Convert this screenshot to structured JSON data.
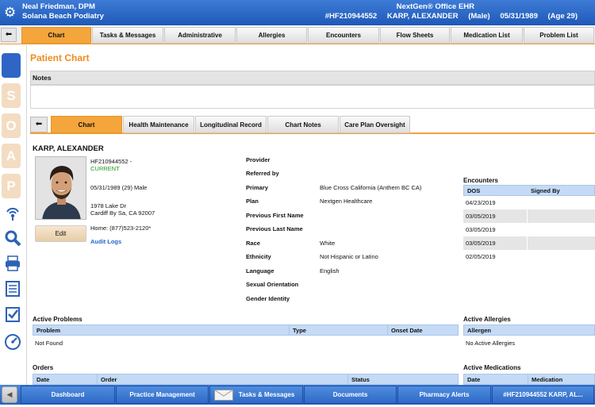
{
  "header": {
    "provider_name": "Neal Friedman, DPM",
    "practice_name": "Solana Beach Podiatry",
    "app_title": "NextGen® Office EHR",
    "patient_id": "#HF210944552",
    "patient_name": "KARP, ALEXANDER",
    "patient_sex": "(Male)",
    "patient_dob": "05/31/1989",
    "patient_age": "(Age 29)"
  },
  "nav": {
    "back_glyph": "⬅",
    "tabs": [
      "Chart",
      "Tasks & Messages",
      "Administrative",
      "Allergies",
      "Encounters",
      "Flow Sheets",
      "Medication List",
      "Problem List"
    ]
  },
  "sidebar": {
    "soap_letters": [
      "",
      "S",
      "O",
      "A",
      "P"
    ],
    "icons": [
      "wireless-icon",
      "search-icon",
      "printer-icon",
      "list-icon",
      "checklist-icon",
      "gauge-icon"
    ]
  },
  "page": {
    "title": "Patient Chart",
    "notes_label": "Notes"
  },
  "subtabs": [
    "Chart",
    "Health Maintenance",
    "Longitudinal Record",
    "Chart Notes",
    "Care Plan Oversight"
  ],
  "patient": {
    "name": "KARP, ALEXANDER",
    "id": "HF210944552 -",
    "status": "CURRENT",
    "dob_line": "05/31/1989 (29) Male",
    "address1": "1978 Lake Dr",
    "address2": "Cardiff By Sa, CA 92007",
    "home_phone": "Home: (877)523-2120*",
    "edit_label": "Edit",
    "audit_logs": "Audit Logs"
  },
  "fields": [
    {
      "label": "Provider",
      "value": ""
    },
    {
      "label": "Referred by",
      "value": ""
    },
    {
      "label": "Primary",
      "value": "Blue Cross California (Anthem BC CA)"
    },
    {
      "label": "Plan",
      "value": "Nextgen Healthcare"
    },
    {
      "label": "Previous First Name",
      "value": ""
    },
    {
      "label": "Previous Last Name",
      "value": ""
    },
    {
      "label": "Race",
      "value": "White"
    },
    {
      "label": "Ethnicity",
      "value": "Not Hispanic or Latino"
    },
    {
      "label": "Language",
      "value": "English"
    },
    {
      "label": "Sexual Orientation",
      "value": ""
    },
    {
      "label": "Gender Identity",
      "value": ""
    }
  ],
  "encounters": {
    "title": "Encounters",
    "columns": [
      "DOS",
      "Signed By"
    ],
    "rows": [
      {
        "dos": "04/23/2019",
        "signed_by": ""
      },
      {
        "dos": "03/05/2019",
        "signed_by": ""
      },
      {
        "dos": "03/05/2019",
        "signed_by": ""
      },
      {
        "dos": "03/05/2019",
        "signed_by": ""
      },
      {
        "dos": "02/05/2019",
        "signed_by": ""
      }
    ]
  },
  "active_problems": {
    "title": "Active Problems",
    "columns": [
      "Problem",
      "Type",
      "Onset Date"
    ],
    "empty": "Not Found"
  },
  "active_allergies": {
    "title": "Active Allergies",
    "column": "Allergen",
    "empty": "No Active Allergies"
  },
  "orders": {
    "title": "Orders",
    "columns": [
      "Date",
      "Order",
      "Status"
    ]
  },
  "active_medications": {
    "title": "Active Medications",
    "columns": [
      "Date",
      "Medication"
    ]
  },
  "bottom_nav": {
    "back_glyph": "◀",
    "items": [
      "Dashboard",
      "Practice Management",
      "Tasks & Messages",
      "Documents",
      "Pharmacy Alerts",
      "#HF210944552  KARP, AL..."
    ]
  }
}
